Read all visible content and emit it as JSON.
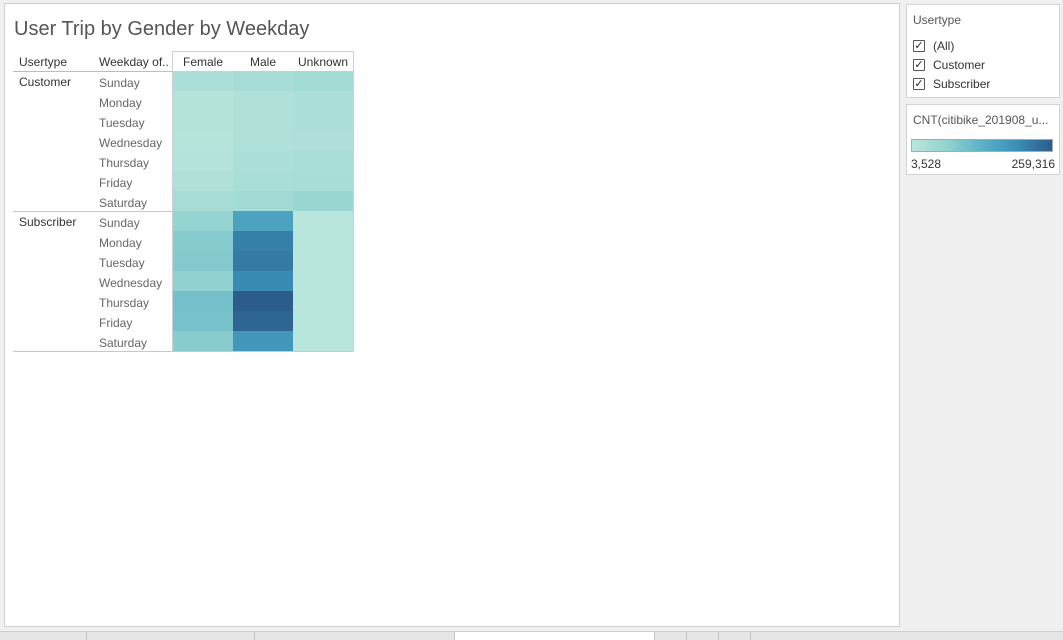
{
  "title": "User Trip by Gender by Weekday",
  "table_headers": {
    "usertype": "Usertype",
    "weekday": "Weekday of..",
    "female": "Female",
    "male": "Male",
    "unknown": "Unknown"
  },
  "filter": {
    "title": "Usertype",
    "items": [
      {
        "label": "(All)",
        "checked": true
      },
      {
        "label": "Customer",
        "checked": true
      },
      {
        "label": "Subscriber",
        "checked": true
      }
    ]
  },
  "legend": {
    "title": "CNT(citibike_201908_u...",
    "min_label": "3,528",
    "max_label": "259,316",
    "min": 3528,
    "max": 259316
  },
  "colors": {
    "low": "#b9e6dc",
    "mid_low": "#93d2d0",
    "mid": "#5ab1c6",
    "mid_high": "#3a8fb7",
    "high": "#2b5c8a"
  },
  "chart_data": {
    "type": "heatmap",
    "title": "User Trip by Gender by Weekday",
    "columns": [
      "Female",
      "Male",
      "Unknown"
    ],
    "color_range": [
      3528,
      259316
    ],
    "groups": [
      {
        "name": "Customer",
        "rows": [
          {
            "weekday": "Sunday",
            "values": [
              25000,
              32000,
              40000
            ]
          },
          {
            "weekday": "Monday",
            "values": [
              12000,
              20000,
              26000
            ]
          },
          {
            "weekday": "Tuesday",
            "values": [
              12000,
              21000,
              25000
            ]
          },
          {
            "weekday": "Wednesday",
            "values": [
              10000,
              18000,
              22000
            ]
          },
          {
            "weekday": "Thursday",
            "values": [
              14000,
              26000,
              30000
            ]
          },
          {
            "weekday": "Friday",
            "values": [
              19000,
              30000,
              33000
            ]
          },
          {
            "weekday": "Saturday",
            "values": [
              34000,
              42000,
              55000
            ]
          }
        ]
      },
      {
        "name": "Subscriber",
        "rows": [
          {
            "weekday": "Sunday",
            "values": [
              62000,
              160000,
              3528
            ]
          },
          {
            "weekday": "Monday",
            "values": [
              82000,
              215000,
              3700
            ]
          },
          {
            "weekday": "Tuesday",
            "values": [
              85000,
              222000,
              3800
            ]
          },
          {
            "weekday": "Wednesday",
            "values": [
              70000,
              200000,
              3700
            ]
          },
          {
            "weekday": "Thursday",
            "values": [
              102000,
              259316,
              4000
            ]
          },
          {
            "weekday": "Friday",
            "values": [
              98000,
              248000,
              3900
            ]
          },
          {
            "weekday": "Saturday",
            "values": [
              80000,
              180000,
              3600
            ]
          }
        ]
      }
    ]
  }
}
